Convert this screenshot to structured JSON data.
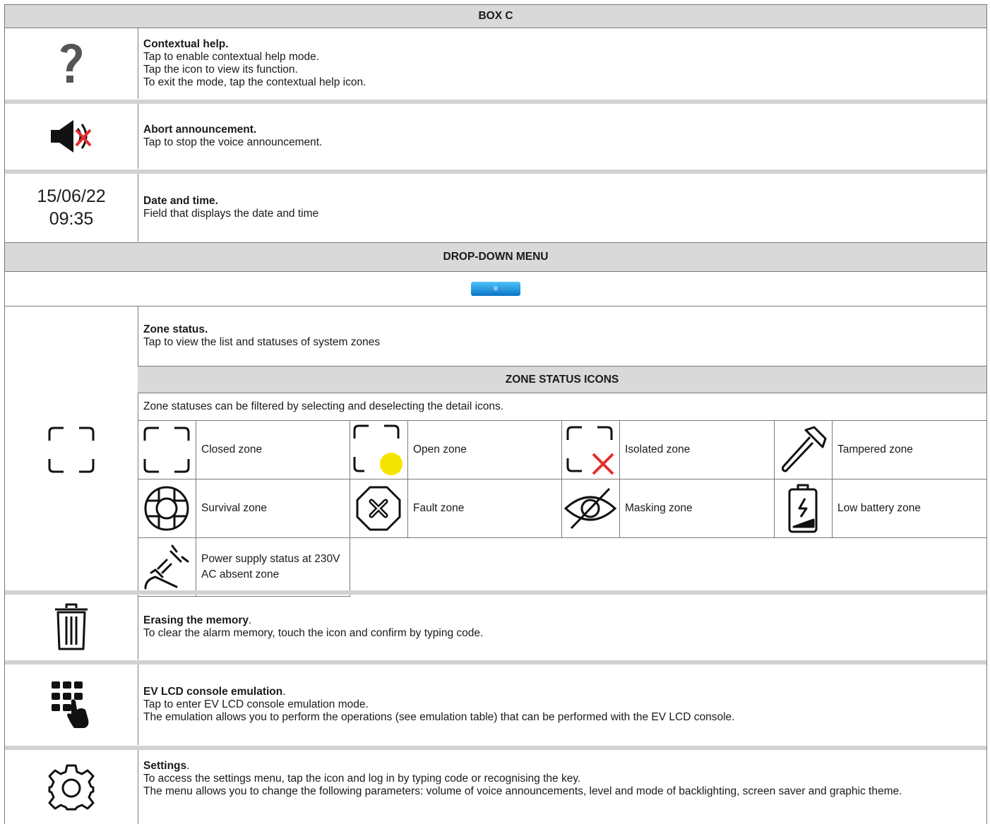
{
  "box_c": {
    "title": "BOX C",
    "rows": [
      {
        "title": "Contextual help.",
        "lines": [
          "Tap to enable contextual help mode.",
          "Tap the icon to view its function.",
          "To exit the mode, tap the contextual help icon."
        ],
        "icon": "question-mark-icon"
      },
      {
        "title": "Abort announcement.",
        "lines": [
          "Tap to stop the voice announcement."
        ],
        "icon": "speaker-mute-icon"
      },
      {
        "title": "Date and time.",
        "lines": [
          "Field that displays the date and time"
        ],
        "date": "15/06/22",
        "time": "09:35"
      }
    ]
  },
  "dropdown": {
    "title": "DROP-DOWN MENU",
    "button_glyph": "≡",
    "zone": {
      "title": "Zone status.",
      "desc": "Tap to view the list and statuses of system zones",
      "icons_header": "ZONE STATUS ICONS",
      "filter_note": "Zone statuses can be filtered by selecting and deselecting the detail icons.",
      "items": [
        {
          "label": "Closed zone",
          "icon": "closed-zone-icon"
        },
        {
          "label": "Open zone",
          "icon": "open-zone-icon"
        },
        {
          "label": "Isolated zone",
          "icon": "isolated-zone-icon"
        },
        {
          "label": "Tampered zone",
          "icon": "hammer-icon"
        },
        {
          "label": "Survival zone",
          "icon": "lifebuoy-icon"
        },
        {
          "label": "Fault zone",
          "icon": "octagon-x-icon"
        },
        {
          "label": "Masking zone",
          "icon": "eye-off-icon"
        },
        {
          "label": "Low battery zone",
          "icon": "battery-low-icon"
        },
        {
          "label": "Power supply status at 230V AC absent zone",
          "icon": "power-plug-off-icon"
        }
      ]
    },
    "erase": {
      "title": "Erasing the memory",
      "suffix": ".",
      "lines": [
        "To clear the alarm memory, touch the icon and confirm by typing code."
      ]
    },
    "emulation": {
      "title": "EV LCD console emulation",
      "suffix": ".",
      "lines": [
        "Tap to enter EV LCD console emulation mode.",
        "The emulation allows you to perform the operations (see emulation table) that can be performed with the EV LCD console."
      ]
    },
    "settings": {
      "title": "Settings",
      "suffix": ".",
      "lines": [
        "To access the settings menu, tap the icon and log in by typing code or recognising the key.",
        "The menu allows you to change the following parameters: volume of voice announcements, level and mode of backlighting, screen saver and graphic theme."
      ]
    }
  },
  "colors": {
    "header_bg": "#d9d9d9",
    "yellow": "#f5e400",
    "red": "#e32d2d",
    "menu_blue": "#1e88e5"
  }
}
